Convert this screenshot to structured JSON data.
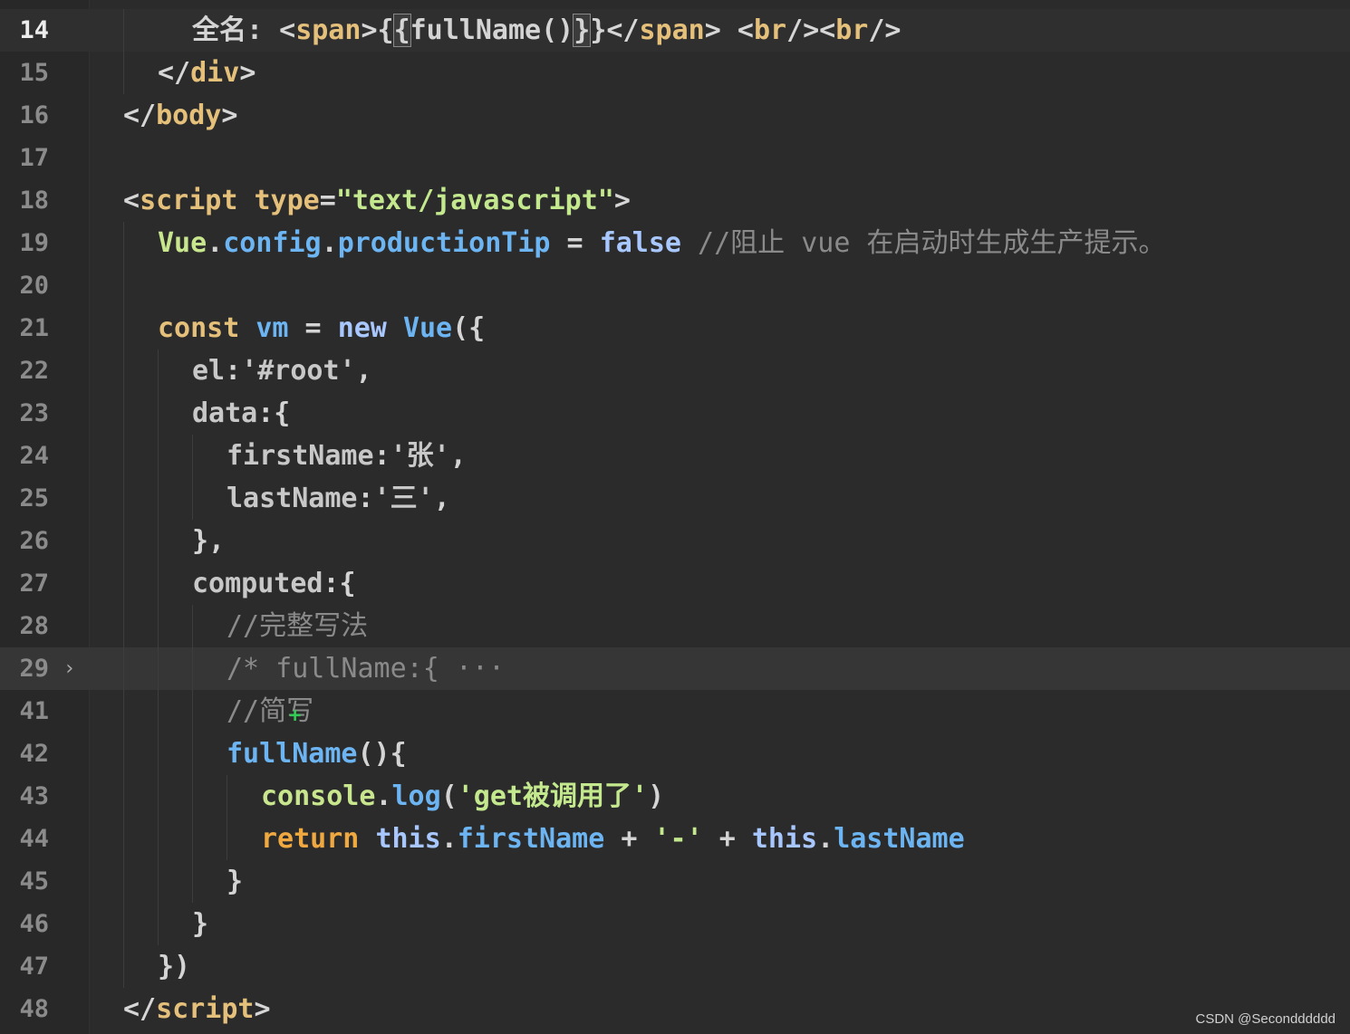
{
  "lines": [
    {
      "num": "14",
      "tokens": [
        {
          "t": "全名: ",
          "c": "t-plain"
        },
        {
          "t": "<",
          "c": "t-punc"
        },
        {
          "t": "span",
          "c": "t-tag"
        },
        {
          "t": ">",
          "c": "t-punc"
        },
        {
          "t": "{",
          "c": "t-plain"
        },
        {
          "t": "{",
          "c": "t-plain",
          "hl": true
        },
        {
          "t": "fullName()",
          "c": "t-plain"
        },
        {
          "t": "}",
          "c": "t-plain",
          "hl": true,
          "cursor": true
        },
        {
          "t": "}",
          "c": "t-plain"
        },
        {
          "t": "</",
          "c": "t-punc"
        },
        {
          "t": "span",
          "c": "t-tag"
        },
        {
          "t": "> ",
          "c": "t-punc"
        },
        {
          "t": "<",
          "c": "t-punc"
        },
        {
          "t": "br",
          "c": "t-tag"
        },
        {
          "t": "/><",
          "c": "t-punc"
        },
        {
          "t": "br",
          "c": "t-tag"
        },
        {
          "t": "/>",
          "c": "t-punc"
        }
      ]
    },
    {
      "num": "15",
      "tokens": [
        {
          "t": "</",
          "c": "t-punc"
        },
        {
          "t": "div",
          "c": "t-tag"
        },
        {
          "t": ">",
          "c": "t-punc"
        }
      ]
    },
    {
      "num": "16",
      "tokens": [
        {
          "t": "</",
          "c": "t-punc"
        },
        {
          "t": "body",
          "c": "t-tag"
        },
        {
          "t": ">",
          "c": "t-punc"
        }
      ]
    },
    {
      "num": "17",
      "tokens": []
    },
    {
      "num": "18",
      "tokens": [
        {
          "t": "<",
          "c": "t-punc"
        },
        {
          "t": "script",
          "c": "t-tag"
        },
        {
          "t": " ",
          "c": "t-plain"
        },
        {
          "t": "type",
          "c": "t-key"
        },
        {
          "t": "=",
          "c": "t-punc"
        },
        {
          "t": "\"text/javascript\"",
          "c": "t-str"
        },
        {
          "t": ">",
          "c": "t-punc"
        }
      ]
    },
    {
      "num": "19",
      "tokens": [
        {
          "t": "Vue",
          "c": "t-obj"
        },
        {
          "t": ".",
          "c": "t-plain"
        },
        {
          "t": "config",
          "c": "t-prop"
        },
        {
          "t": ".",
          "c": "t-plain"
        },
        {
          "t": "productionTip",
          "c": "t-prop"
        },
        {
          "t": " = ",
          "c": "t-plain"
        },
        {
          "t": "false",
          "c": "t-bool"
        },
        {
          "t": " //阻止 vue 在启动时生成生产提示。",
          "c": "t-cmt"
        }
      ]
    },
    {
      "num": "20",
      "tokens": []
    },
    {
      "num": "21",
      "tokens": [
        {
          "t": "const",
          "c": "t-key"
        },
        {
          "t": " ",
          "c": "t-plain"
        },
        {
          "t": "vm",
          "c": "t-prop"
        },
        {
          "t": " = ",
          "c": "t-plain"
        },
        {
          "t": "new",
          "c": "t-bool"
        },
        {
          "t": " ",
          "c": "t-plain"
        },
        {
          "t": "Vue",
          "c": "t-cls"
        },
        {
          "t": "({",
          "c": "t-plain"
        }
      ]
    },
    {
      "num": "22",
      "tokens": [
        {
          "t": "el",
          "c": "t-attr"
        },
        {
          "t": ":",
          "c": "t-plain"
        },
        {
          "t": "'#root'",
          "c": "t-id"
        },
        {
          "t": ",",
          "c": "t-plain"
        }
      ]
    },
    {
      "num": "23",
      "tokens": [
        {
          "t": "data",
          "c": "t-attr"
        },
        {
          "t": ":{",
          "c": "t-plain"
        }
      ]
    },
    {
      "num": "24",
      "tokens": [
        {
          "t": "firstName",
          "c": "t-attr"
        },
        {
          "t": ":",
          "c": "t-plain"
        },
        {
          "t": "'张'",
          "c": "t-id"
        },
        {
          "t": ",",
          "c": "t-plain"
        }
      ]
    },
    {
      "num": "25",
      "tokens": [
        {
          "t": "lastName",
          "c": "t-attr"
        },
        {
          "t": ":",
          "c": "t-plain"
        },
        {
          "t": "'三'",
          "c": "t-id"
        },
        {
          "t": ",",
          "c": "t-plain"
        }
      ]
    },
    {
      "num": "26",
      "tokens": [
        {
          "t": "},",
          "c": "t-plain"
        }
      ]
    },
    {
      "num": "27",
      "tokens": [
        {
          "t": "computed",
          "c": "t-attr"
        },
        {
          "t": ":{",
          "c": "t-plain"
        }
      ]
    },
    {
      "num": "28",
      "tokens": [
        {
          "t": "//完整写法",
          "c": "t-cmt"
        }
      ]
    },
    {
      "num": "29",
      "fold": "›",
      "tokens": [
        {
          "t": "/* fullName:{ ···",
          "c": "t-cmt"
        }
      ]
    },
    {
      "num": "41",
      "tokens": [
        {
          "t": "//简写",
          "c": "t-cmt"
        }
      ]
    },
    {
      "num": "42",
      "tokens": [
        {
          "t": "fullName",
          "c": "t-prop"
        },
        {
          "t": "(){",
          "c": "t-plain"
        }
      ]
    },
    {
      "num": "43",
      "tokens": [
        {
          "t": "console",
          "c": "t-obj"
        },
        {
          "t": ".",
          "c": "t-plain"
        },
        {
          "t": "log",
          "c": "t-prop"
        },
        {
          "t": "(",
          "c": "t-plain"
        },
        {
          "t": "'get被调用了'",
          "c": "t-str"
        },
        {
          "t": ")",
          "c": "t-plain"
        }
      ]
    },
    {
      "num": "44",
      "tokens": [
        {
          "t": "return",
          "c": "t-ret"
        },
        {
          "t": " ",
          "c": "t-plain"
        },
        {
          "t": "this",
          "c": "t-this"
        },
        {
          "t": ".",
          "c": "t-plain"
        },
        {
          "t": "firstName",
          "c": "t-prop"
        },
        {
          "t": " + ",
          "c": "t-plain"
        },
        {
          "t": "'-'",
          "c": "t-str"
        },
        {
          "t": " + ",
          "c": "t-plain"
        },
        {
          "t": "this",
          "c": "t-this"
        },
        {
          "t": ".",
          "c": "t-plain"
        },
        {
          "t": "lastName",
          "c": "t-prop"
        }
      ]
    },
    {
      "num": "45",
      "tokens": [
        {
          "t": "}",
          "c": "t-plain"
        }
      ]
    },
    {
      "num": "46",
      "tokens": [
        {
          "t": "}",
          "c": "t-plain"
        }
      ]
    },
    {
      "num": "47",
      "tokens": [
        {
          "t": "})",
          "c": "t-plain"
        }
      ]
    },
    {
      "num": "48",
      "tokens": [
        {
          "t": "</",
          "c": "t-punc"
        },
        {
          "t": "script",
          "c": "t-tag"
        },
        {
          "t": ">",
          "c": "t-punc"
        }
      ]
    }
  ],
  "change_marker": "+",
  "watermark": "CSDN @Secondddddd"
}
